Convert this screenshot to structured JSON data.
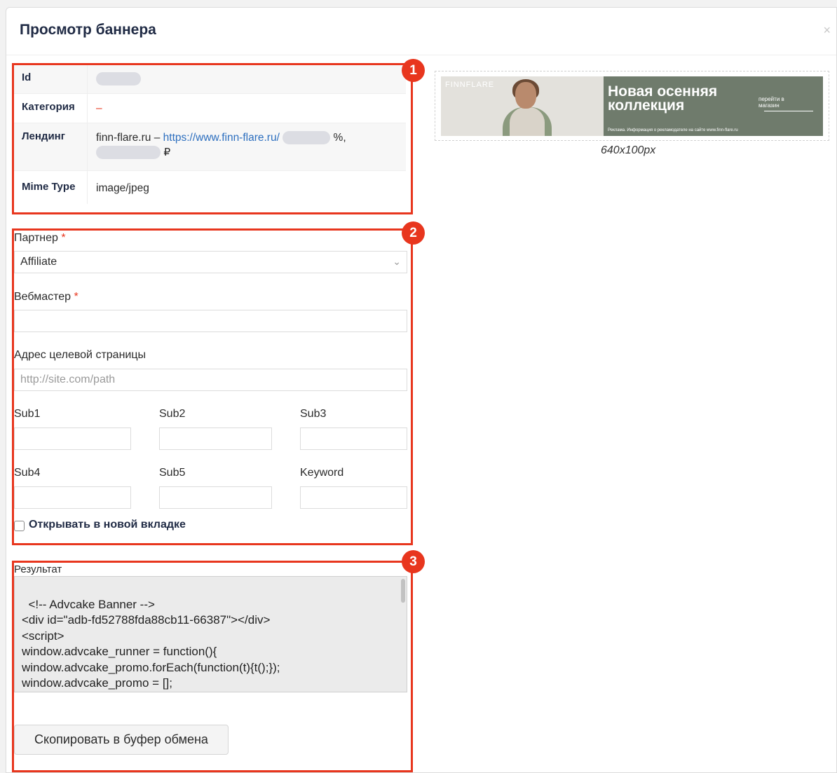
{
  "modal": {
    "title": "Просмотр баннера",
    "close_glyph": "×"
  },
  "badges": [
    "1",
    "2",
    "3"
  ],
  "info": {
    "id_label": "Id",
    "category_label": "Категория",
    "category_value": "–",
    "landing_label": "Лендинг",
    "landing_prefix": "finn-flare.ru – ",
    "landing_link": "https://www.finn-flare.ru/",
    "landing_pct": "%,",
    "landing_currency": "₽",
    "mime_label": "Mime Type",
    "mime_value": "image/jpeg"
  },
  "form": {
    "partner_label": "Партнер",
    "partner_value": "Affiliate",
    "webmaster_label": "Вебмастер",
    "url_label": "Адрес целевой страницы",
    "url_placeholder": "http://site.com/path",
    "sub1": "Sub1",
    "sub2": "Sub2",
    "sub3": "Sub3",
    "sub4": "Sub4",
    "sub5": "Sub5",
    "keyword": "Keyword",
    "new_tab_label": "Открывать в новой вкладке",
    "required_mark": "*"
  },
  "result": {
    "label": "Результат",
    "code": "<!-- Advcake Banner -->\n<div id=\"adb-fd52788fda88cb11-66387\"></div>\n<script>\nwindow.advcake_runner = function(){\nwindow.advcake_promo.forEach(function(t){t();});\nwindow.advcake_promo = [];\nwindow.advcake_promo.push = function(t){t();};",
    "copy_button": "Скопировать в буфер обмена"
  },
  "banner": {
    "brand": "FINNFLARE",
    "headline": "Новая осенняя коллекция",
    "cta": "перейти в магазин",
    "disclaimer": "Реклама. Информация о рекламодателе на сайте www.finn-flare.ru",
    "size": "640x100px"
  }
}
